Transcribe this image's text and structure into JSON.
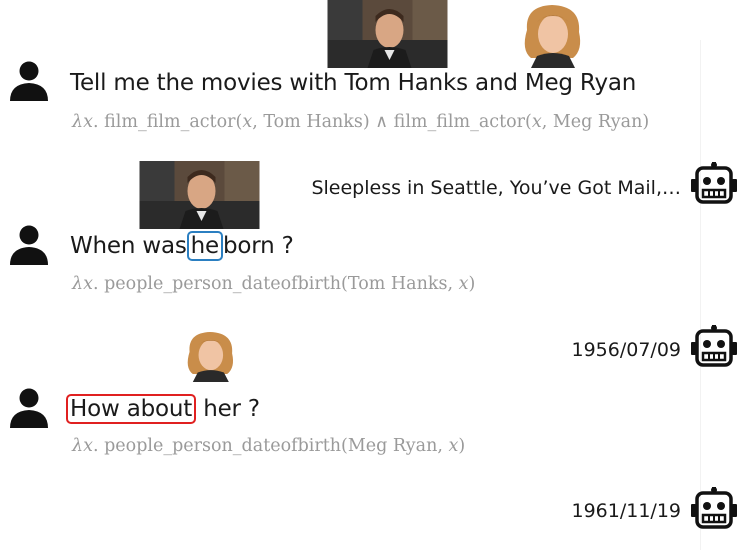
{
  "turns": [
    {
      "question": "Tell me the movies with Tom Hanks and Meg Ryan",
      "logical_form": {
        "lambda": "λ",
        "var": "x",
        "text_a": ". film_film_actor(",
        "text_b": ", Tom Hanks) ∧ film_film_actor(",
        "text_c": ", Meg Ryan)"
      },
      "answer": "Sleepless in Seattle, You’ve Got Mail,…"
    },
    {
      "question_pre": "When was",
      "question_highlight": "he",
      "question_post": "born ?",
      "logical_form": {
        "lambda": "λ",
        "var": "x",
        "text_a": ". people_person_dateofbirth(Tom Hanks, ",
        "text_b": ")"
      },
      "answer": "1956/07/09"
    },
    {
      "question_highlight": "How about",
      "question_post": "her ?",
      "logical_form": {
        "lambda": "λ",
        "var": "x",
        "text_a": ". people_person_dateofbirth(Meg Ryan, ",
        "text_b": ")"
      },
      "answer": "1961/11/19"
    }
  ],
  "highlight_colors": {
    "coreference": "#2b7fc1",
    "ellipsis": "#e02020"
  },
  "icons": {
    "user": "user-icon",
    "bot": "robot-icon",
    "photo_tom": "tom-hanks-photo",
    "photo_meg": "meg-ryan-photo"
  }
}
